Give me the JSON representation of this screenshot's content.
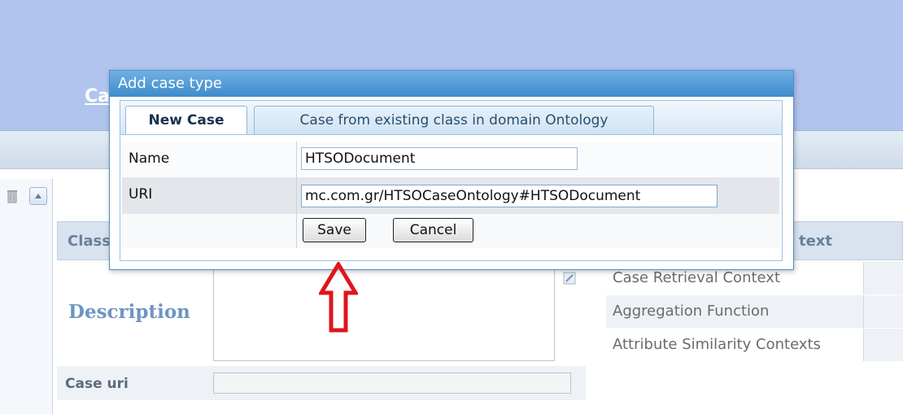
{
  "background": {
    "page_title_initial": "Ca",
    "class_header": "Class",
    "description_label": "Description",
    "case_uri_label": "Case uri",
    "right_header": "text",
    "right_rows": [
      {
        "label": "Case Retrieval Context"
      },
      {
        "label": "Aggregation Function"
      },
      {
        "label": "Attribute Similarity Contexts"
      }
    ]
  },
  "dialog": {
    "title": "Add case type",
    "tabs": [
      {
        "label": "New Case",
        "active": true
      },
      {
        "label": "Case from existing class in domain Ontology",
        "active": false
      }
    ],
    "form": {
      "name_label": "Name",
      "name_value": "HTSODocument",
      "uri_label": "URI",
      "uri_value": "mc.com.gr/HTSOCaseOntology#HTSODocument"
    },
    "buttons": {
      "save": "Save",
      "cancel": "Cancel"
    }
  },
  "colors": {
    "header_bg": "#b1c4ee",
    "dialog_title": "#4a95d3",
    "annotation_arrow": "#e0141c"
  },
  "icons": [
    "trash-icon",
    "arrow-up-icon",
    "edit-icon",
    "annotation-arrow-icon"
  ]
}
